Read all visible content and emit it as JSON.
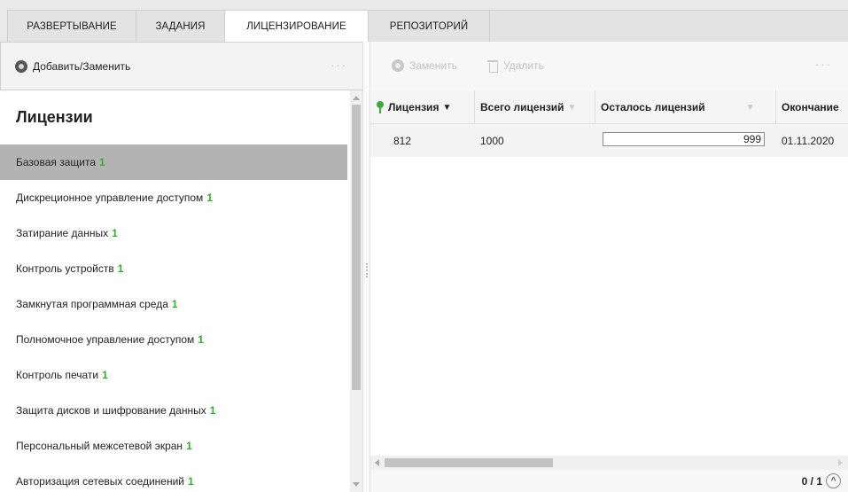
{
  "tabs": [
    {
      "label": "РАЗВЕРТЫВАНИЕ"
    },
    {
      "label": "ЗАДАНИЯ"
    },
    {
      "label": "ЛИЦЕНЗИРОВАНИЕ"
    },
    {
      "label": "РЕПОЗИТОРИЙ"
    }
  ],
  "left_toolbar": {
    "add_replace_label": "Добавить/Заменить",
    "more": "···"
  },
  "licenses": {
    "title": "Лицензии",
    "items": [
      {
        "label": "Базовая защита",
        "count": "1"
      },
      {
        "label": "Дискреционное управление доступом",
        "count": "1"
      },
      {
        "label": "Затирание данных",
        "count": "1"
      },
      {
        "label": "Контроль устройств",
        "count": "1"
      },
      {
        "label": "Замкнутая программная среда",
        "count": "1"
      },
      {
        "label": "Полномочное управление доступом",
        "count": "1"
      },
      {
        "label": "Контроль печати",
        "count": "1"
      },
      {
        "label": "Защита дисков и шифрование данных",
        "count": "1"
      },
      {
        "label": "Персональный межсетевой экран",
        "count": "1"
      },
      {
        "label": "Авторизация сетевых соединений",
        "count": "1"
      }
    ]
  },
  "right_toolbar": {
    "replace_label": "Заменить",
    "delete_label": "Удалить",
    "more": "···"
  },
  "grid": {
    "columns": [
      {
        "label": "Лицензия",
        "sort": "▼"
      },
      {
        "label": "Всего лицензий",
        "sort": "▼"
      },
      {
        "label": "Осталось лицензий",
        "sort": "▼"
      },
      {
        "label": "Окончание"
      }
    ],
    "rows": [
      {
        "license": "812",
        "total": "1000",
        "remaining": "999",
        "remaining_fraction": 0.999,
        "end": "01.11.2020"
      }
    ]
  },
  "pager": {
    "text": "0 / 1",
    "up": "^"
  },
  "colors": {
    "accent_green": "#2db12d",
    "selected_row": "#b3b3b3"
  }
}
